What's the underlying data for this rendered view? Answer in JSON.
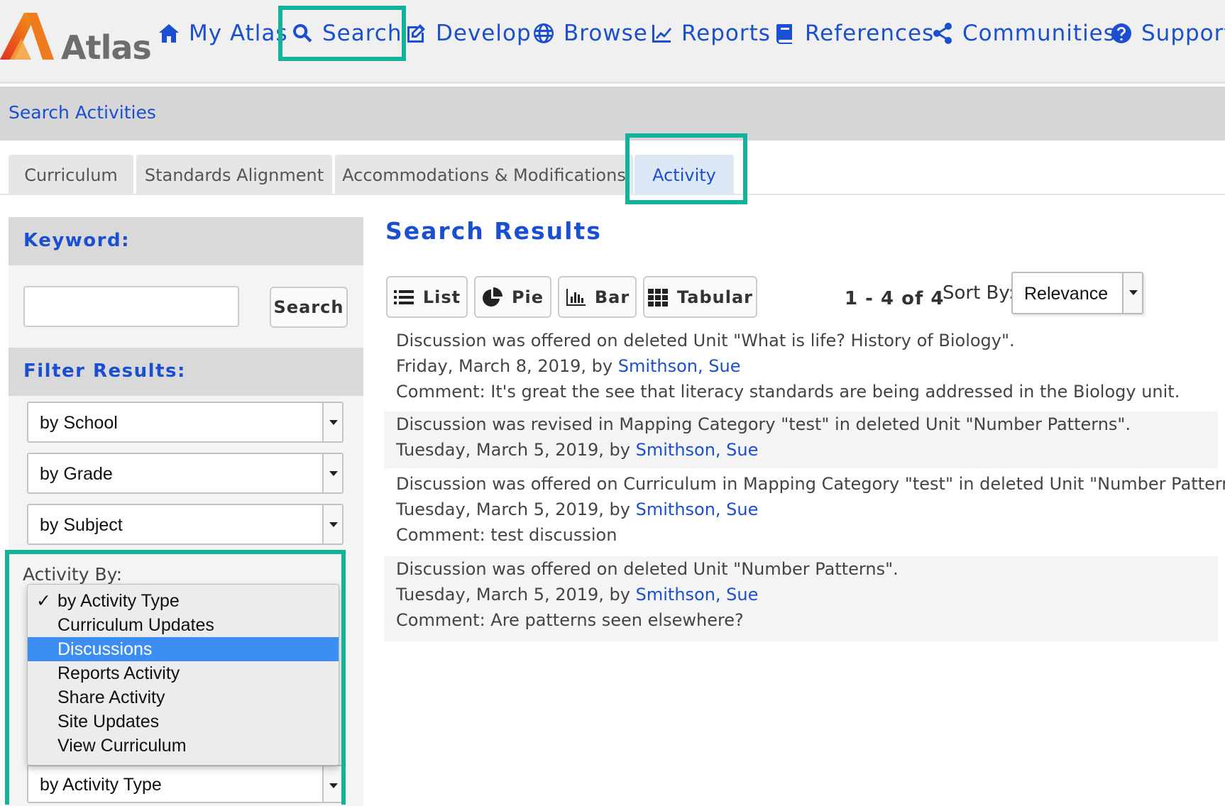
{
  "nav": {
    "logo_text": "Atlas",
    "items": [
      {
        "label": "My Atlas",
        "icon": "home-icon"
      },
      {
        "label": "Search",
        "icon": "search-icon"
      },
      {
        "label": "Develop",
        "icon": "edit-icon"
      },
      {
        "label": "Browse",
        "icon": "globe-icon"
      },
      {
        "label": "Reports",
        "icon": "chart-icon"
      },
      {
        "label": "References",
        "icon": "book-icon"
      },
      {
        "label": "Communities",
        "icon": "share-icon"
      },
      {
        "label": "Support",
        "icon": "help-icon"
      }
    ]
  },
  "section": {
    "title": "Search Activities"
  },
  "tabs": [
    {
      "label": "Curriculum"
    },
    {
      "label": "Standards Alignment"
    },
    {
      "label": "Accommodations & Modifications"
    },
    {
      "label": "Activity",
      "active": true
    }
  ],
  "sidebar": {
    "keyword_heading": "Keyword:",
    "keyword_value": "",
    "search_button": "Search",
    "filter_heading": "Filter Results:",
    "filters": [
      {
        "selected": "by School"
      },
      {
        "selected": "by Grade"
      },
      {
        "selected": "by Subject"
      }
    ],
    "activity_label": "Activity By:",
    "activity_selected": "by Activity Type",
    "activity_options": [
      {
        "label": "by Activity Type",
        "checked": true
      },
      {
        "label": "Curriculum Updates"
      },
      {
        "label": "Discussions",
        "highlighted": true
      },
      {
        "label": "Reports Activity"
      },
      {
        "label": "Share Activity"
      },
      {
        "label": "Site Updates"
      },
      {
        "label": "View Curriculum"
      }
    ],
    "check_mark": "✓"
  },
  "results": {
    "title": "Search Results",
    "views": [
      {
        "label": "List",
        "icon": "list-icon"
      },
      {
        "label": "Pie",
        "icon": "pie-chart-icon"
      },
      {
        "label": "Bar",
        "icon": "bar-chart-icon"
      },
      {
        "label": "Tabular",
        "icon": "grid-icon"
      }
    ],
    "count": "1 - 4 of 4",
    "sort_label": "Sort By:",
    "sort_value": "Relevance",
    "items": [
      {
        "summary": "Discussion was offered on deleted Unit \"What is life? History of Biology\".",
        "date": "Friday, March 8, 2019, by ",
        "author": "Smithson, Sue",
        "comment": "Comment: It's great the see that literacy standards are being addressed in the Biology unit."
      },
      {
        "summary": "Discussion was revised in Mapping Category \"test\" in deleted Unit \"Number Patterns\".",
        "date": "Tuesday, March 5, 2019, by ",
        "author": "Smithson, Sue",
        "comment": ""
      },
      {
        "summary": "Discussion was offered on Curriculum in Mapping Category \"test\" in deleted Unit \"Number Patterns\".",
        "date": "Tuesday, March 5, 2019, by ",
        "author": "Smithson, Sue",
        "comment": "Comment: test discussion"
      },
      {
        "summary": "Discussion was offered on deleted Unit \"Number Patterns\".",
        "date": "Tuesday, March 5, 2019, by ",
        "author": "Smithson, Sue",
        "comment": "Comment: Are patterns seen elsewhere?"
      }
    ]
  },
  "colors": {
    "link": "#1b4fd1",
    "highlight_box": "#13b39b",
    "selected_option": "#3d8ef2"
  }
}
